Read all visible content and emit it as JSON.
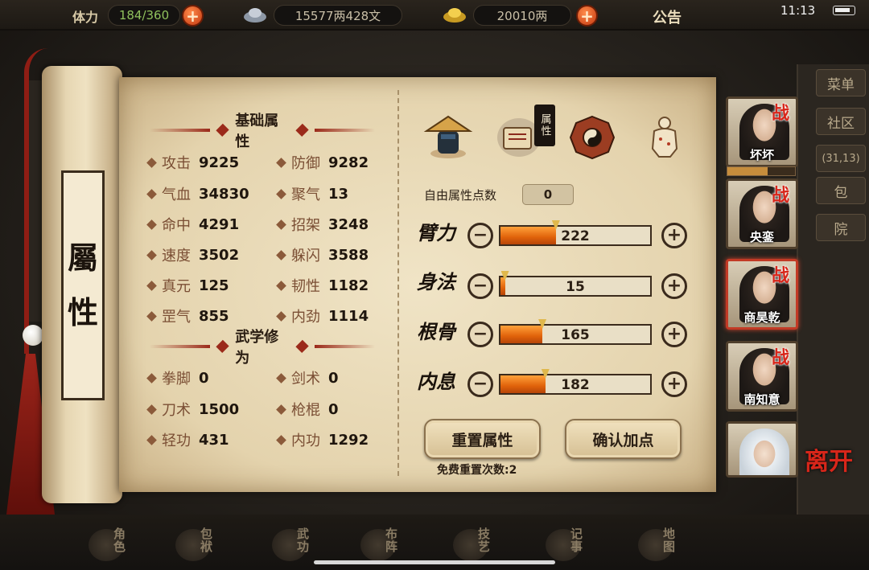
{
  "status_bar": {
    "time": "11:13"
  },
  "topbar": {
    "stamina_label": "体力",
    "stamina_value": "184/360",
    "silver_value": "15577两428文",
    "gold_value": "20010两",
    "notice_label": "公告"
  },
  "background_right_buttons": [
    "菜单",
    "社区",
    "(31,13)",
    "包",
    "院"
  ],
  "scroll_title": [
    "屬",
    "性"
  ],
  "basic_attrs": {
    "title": "基础属性",
    "items": [
      {
        "label": "攻击",
        "value": "9225"
      },
      {
        "label": "防御",
        "value": "9282"
      },
      {
        "label": "气血",
        "value": "34830"
      },
      {
        "label": "聚气",
        "value": "13"
      },
      {
        "label": "命中",
        "value": "4291"
      },
      {
        "label": "招架",
        "value": "3248"
      },
      {
        "label": "速度",
        "value": "3502"
      },
      {
        "label": "躲闪",
        "value": "3588"
      },
      {
        "label": "真元",
        "value": "125"
      },
      {
        "label": "韧性",
        "value": "1182"
      },
      {
        "label": "罡气",
        "value": "855"
      },
      {
        "label": "内劲",
        "value": "1114"
      }
    ]
  },
  "martial_attrs": {
    "title": "武学修为",
    "items": [
      {
        "label": "拳脚",
        "value": "0"
      },
      {
        "label": "剑术",
        "value": "0"
      },
      {
        "label": "刀术",
        "value": "1500"
      },
      {
        "label": "枪棍",
        "value": "0"
      },
      {
        "label": "轻功",
        "value": "431"
      },
      {
        "label": "内功",
        "value": "1292"
      }
    ]
  },
  "tabs": [
    {
      "icon": "character-hat-icon"
    },
    {
      "icon": "scroll-attributes-icon",
      "badge": "属性"
    },
    {
      "icon": "bagua-icon"
    },
    {
      "icon": "meridian-body-icon"
    }
  ],
  "free_points": {
    "label": "自由属性点数",
    "value": "0"
  },
  "attr_points": [
    {
      "name": "臂力",
      "value": "222",
      "fill": 0.37
    },
    {
      "name": "身法",
      "value": "15",
      "fill": 0.03
    },
    {
      "name": "根骨",
      "value": "165",
      "fill": 0.28
    },
    {
      "name": "内息",
      "value": "182",
      "fill": 0.3
    }
  ],
  "buttons": {
    "reset_label": "重置属性",
    "confirm_label": "确认加点",
    "reset_note": "免费重置次数:2"
  },
  "characters": [
    {
      "name": "坏坏",
      "battle": "战",
      "selected": false
    },
    {
      "name": "央銮",
      "battle": "战",
      "selected": false
    },
    {
      "name": "商昊乾",
      "battle": "战",
      "selected": true
    },
    {
      "name": "南知意",
      "battle": "战",
      "selected": false
    },
    {
      "name": "",
      "battle": "",
      "selected": false
    }
  ],
  "leave_label": "离开",
  "bottom_nav": [
    "角色",
    "包袱",
    "武功",
    "布阵",
    "技艺",
    "记事",
    "地图"
  ],
  "colors": {
    "accent_red": "#9b2a1a",
    "bar_orange": "#e0620a",
    "parchment": "#e4d3ad"
  }
}
